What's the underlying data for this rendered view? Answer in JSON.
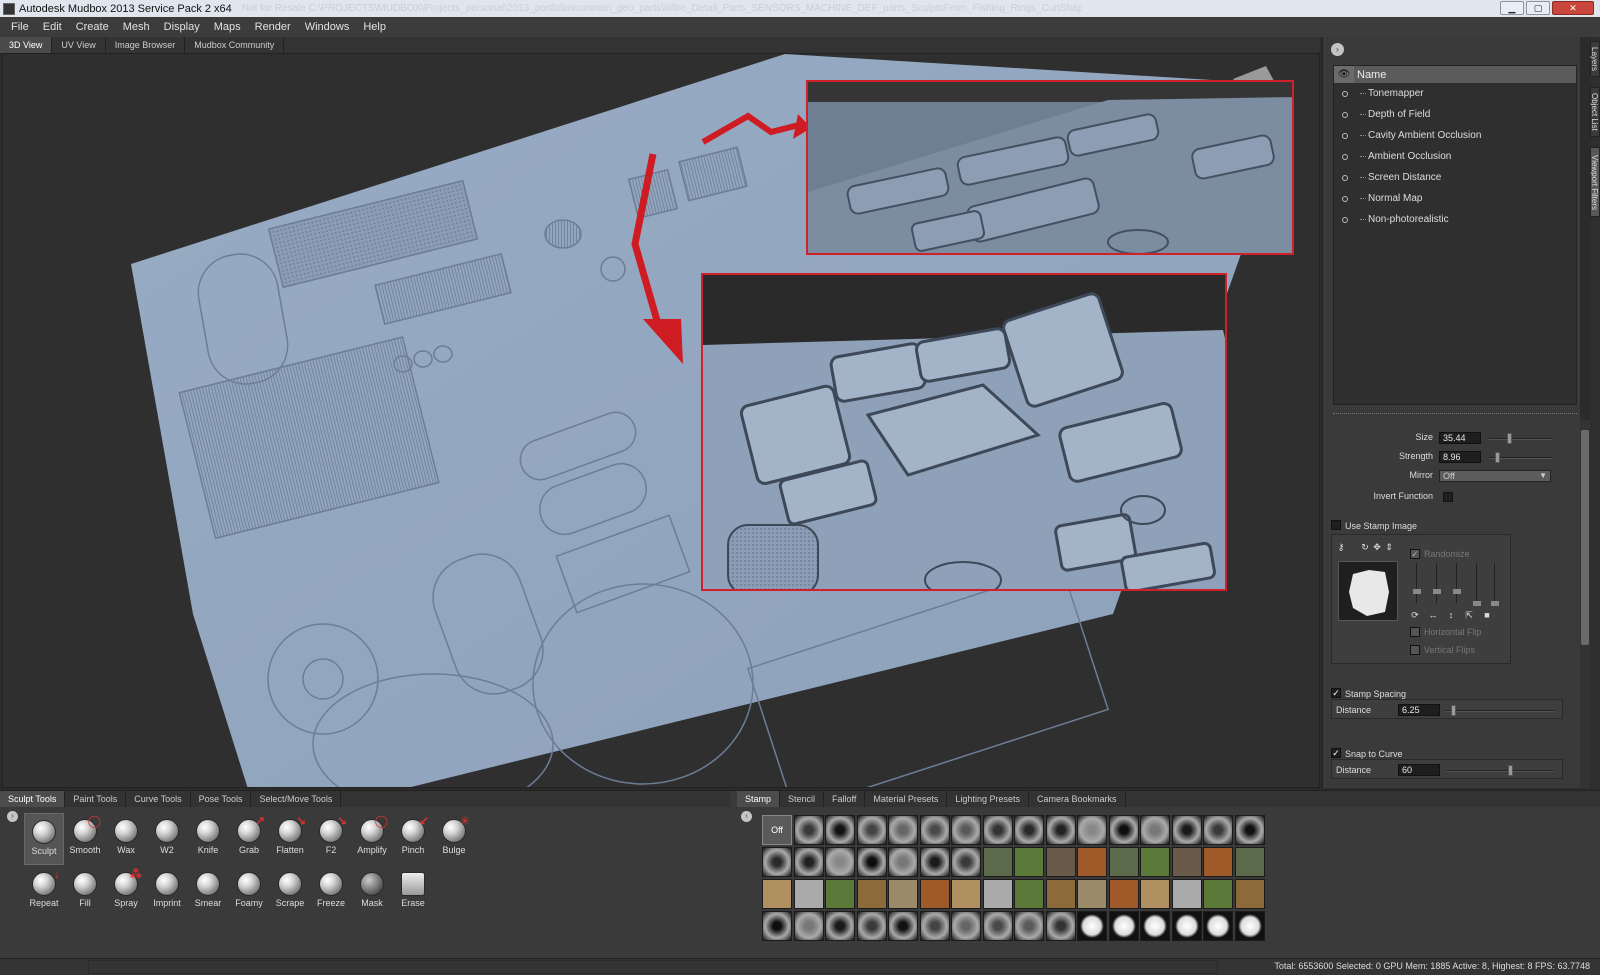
{
  "window": {
    "title": "Autodesk Mudbox 2013 Service Pack 2 x64",
    "path": "Not for Resale C:\\PROJECTS\\MUDBOX\\Projects_personal\\2013_portfolio\\common_geo_parts\\hifire_Detail_Parts_SENSORS_MACHINE_DEF_parts_SculptsFrom_Fishing_Rings_CurlShapes.mud",
    "minimize": "▁",
    "maximize": "▢",
    "close": "✕"
  },
  "menu": [
    "File",
    "Edit",
    "Create",
    "Mesh",
    "Display",
    "Maps",
    "Render",
    "Windows",
    "Help"
  ],
  "view_tabs": [
    {
      "label": "3D View",
      "active": true
    },
    {
      "label": "UV View",
      "active": false
    },
    {
      "label": "Image Browser",
      "active": false
    },
    {
      "label": "Mudbox Community",
      "active": false
    }
  ],
  "right_panel": {
    "collapse_icon": "›",
    "filters_header": "Name",
    "eye_icon": "👁",
    "filters": [
      "Tonemapper",
      "Depth of Field",
      "Cavity Ambient Occlusion",
      "Ambient Occlusion",
      "Screen Distance",
      "Normal Map",
      "Non-photorealistic"
    ],
    "properties": {
      "size_label": "Size",
      "size_value": "35.44",
      "size_level": 0.3,
      "strength_label": "Strength",
      "strength_value": "8.96",
      "strength_level": 0.1,
      "mirror_label": "Mirror",
      "mirror_value": "Off",
      "invert_label": "Invert Function",
      "use_stamp_label": "Use Stamp Image",
      "randomize_label": "Randomize",
      "horizontal_flip_label": "Horizontal Flip",
      "vertical_flips_label": "Vertical Flips",
      "stamp_spacing_label": "Stamp Spacing",
      "spacing_distance_label": "Distance",
      "spacing_distance_value": "6.25",
      "spacing_level": 0.05,
      "snap_curve_label": "Snap to Curve",
      "snap_distance_label": "Distance",
      "snap_distance_value": "60",
      "snap_level": 0.6,
      "check_mark": "✓"
    },
    "side_tabs": [
      "Layers",
      "Object List",
      "Viewport Filters"
    ]
  },
  "tool_tabs": [
    {
      "label": "Sculpt Tools",
      "active": true
    },
    {
      "label": "Paint Tools",
      "active": false
    },
    {
      "label": "Curve Tools",
      "active": false
    },
    {
      "label": "Pose Tools",
      "active": false
    },
    {
      "label": "Select/Move Tools",
      "active": false
    }
  ],
  "tools_row1": [
    "Sculpt",
    "Smooth",
    "Wax",
    "W2",
    "Knife",
    "Grab",
    "Flatten",
    "F2",
    "Amplify",
    "Pinch",
    "Bulge"
  ],
  "tools_row2": [
    "Repeat",
    "Fill",
    "Spray",
    "Imprint",
    "Smear",
    "Foamy",
    "Scrape",
    "Freeze",
    "Mask",
    "Erase"
  ],
  "stamp_tabs": [
    {
      "label": "Stamp",
      "active": true
    },
    {
      "label": "Stencil",
      "active": false
    },
    {
      "label": "Falloff",
      "active": false
    },
    {
      "label": "Material Presets",
      "active": false
    },
    {
      "label": "Lighting Presets",
      "active": false
    },
    {
      "label": "Camera Bookmarks",
      "active": false
    }
  ],
  "stamp_off_label": "Off",
  "status": "Total: 6553600  Selected: 0 GPU Mem: 1885  Active: 8, Highest: 8  FPS: 63.7748"
}
